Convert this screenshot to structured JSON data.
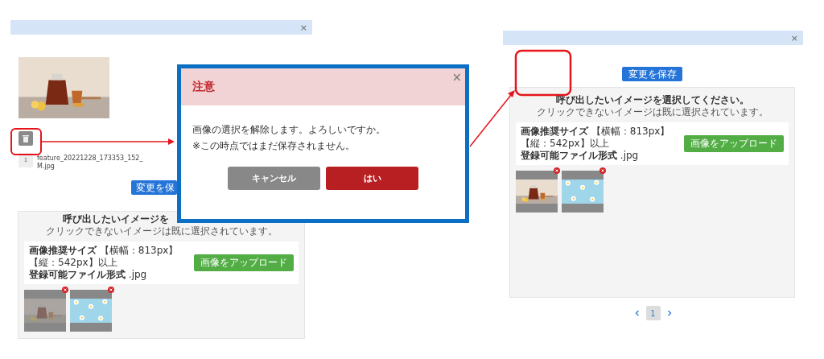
{
  "left_screen": {
    "close": "×",
    "file": {
      "index": "1",
      "name_lines": [
        "feature_20221228_173353_152_",
        "M.jpg"
      ]
    },
    "save_button": "変更を保",
    "gallery": {
      "title": "呼び出したいイメージを",
      "subtitle": "クリックできないイメージは既に選択されています。",
      "size_note": "**画像推奨サイズ** 【横幅：813px】【縦：542px】以上",
      "format_note": "**登録可能ファイル形式** .jpg",
      "upload_button": "画像をアップロード",
      "thumbnails": [
        {
          "dimmed": true
        },
        {
          "dimmed": false
        }
      ]
    }
  },
  "dialog": {
    "title": "注意",
    "close": "×",
    "message_lines": [
      "画像の選択を解除します。よろしいですか。",
      "※この時点ではまだ保存されません。"
    ],
    "buttons": [
      {
        "label": "キャンセル",
        "kind": "cancel"
      },
      {
        "label": "はい",
        "kind": "confirm"
      }
    ]
  },
  "right_screen": {
    "close": "×",
    "save_button": "変更を保存",
    "gallery": {
      "title": "呼び出したいイメージを選択してください。",
      "subtitle": "クリックできないイメージは既に選択されています。",
      "size_note": "**画像推奨サイズ** 【横幅：813px】【縦：542px】以上",
      "format_note": "**登録可能ファイル形式** .jpg",
      "upload_button": "画像をアップロード",
      "thumbnails": [
        {
          "dimmed": false
        },
        {
          "dimmed": false
        }
      ]
    },
    "pagination": {
      "pages": [
        {
          "label": "1",
          "selected": true
        }
      ]
    }
  }
}
